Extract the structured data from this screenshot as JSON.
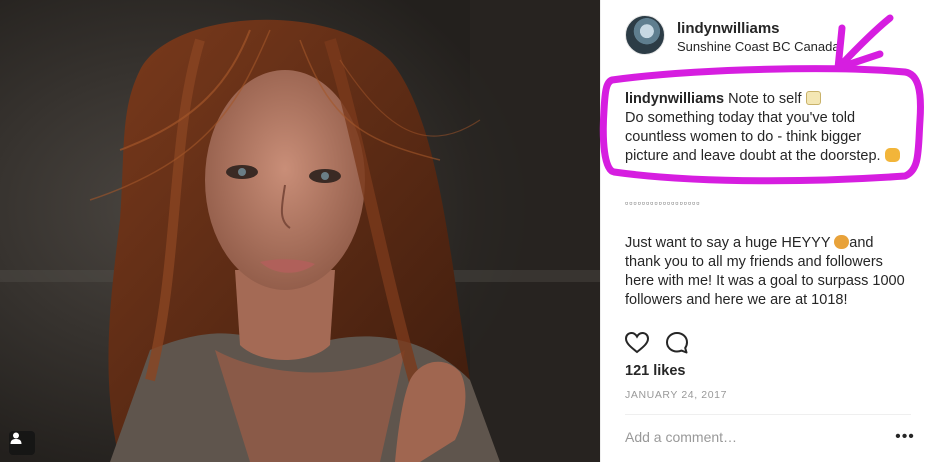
{
  "post": {
    "username": "lindynwilliams",
    "location": "Sunshine Coast BC Canada",
    "caption_line1_rest": " Note to self",
    "caption_line2": "Do something today that you've told",
    "caption_line3": "countless women to do - think bigger",
    "caption_line4": "picture and leave doubt at the doorstep.",
    "separator": "▫▫▫▫▫▫▫▫▫▫▫▫▫▫▫▫▫▫",
    "body_line1a": "Just want to say a huge HEYYY ",
    "body_line1b": "and",
    "body_line2": "thank you to all my friends and followers",
    "body_line3": "here with me! It was a goal to surpass 1000",
    "body_line4": "followers and here we are at 1018!",
    "likes": "121 likes",
    "date": "JANUARY 24, 2017",
    "comment_placeholder": "Add a comment…",
    "more_label": "•••"
  },
  "icons": {
    "like": "heart-outline-icon",
    "comment": "speech-bubble-icon",
    "tag": "person-tag-icon",
    "memo_emoji": "memo-emoji",
    "fist_emoji": "fist-emoji",
    "wave_emoji": "person-raising-hand-emoji"
  },
  "colors": {
    "annotation": "#d61ee0",
    "text": "#262626",
    "muted": "#999999"
  }
}
